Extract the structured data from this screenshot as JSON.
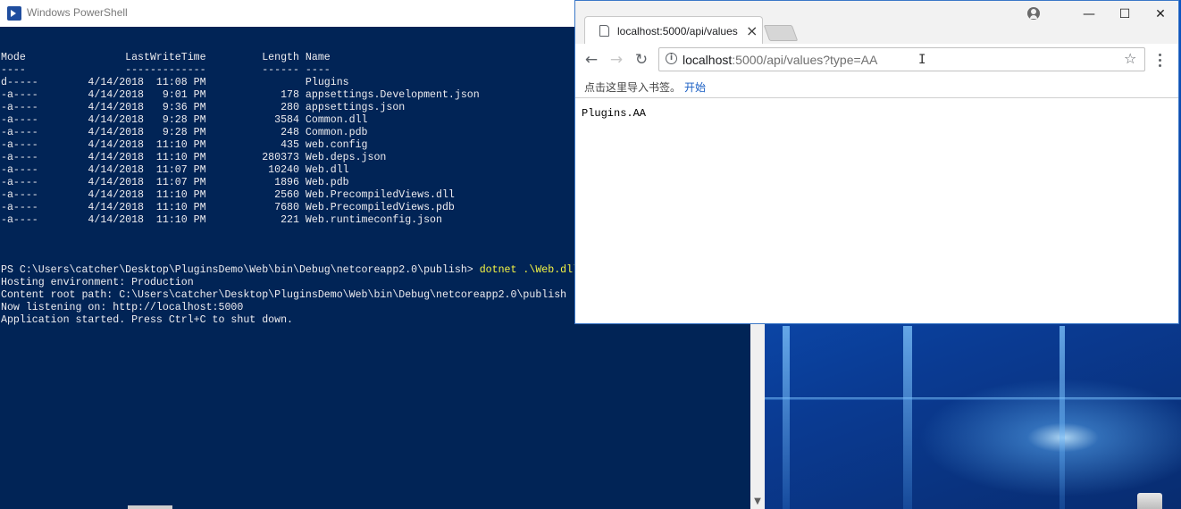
{
  "powershell": {
    "title": "Windows PowerShell",
    "lines": [
      "",
      "",
      "Mode                LastWriteTime         Length Name",
      "----                -------------         ------ ----",
      "d-----        4/14/2018  11:08 PM                Plugins",
      "-a----        4/14/2018   9:01 PM            178 appsettings.Development.json",
      "-a----        4/14/2018   9:36 PM            280 appsettings.json",
      "-a----        4/14/2018   9:28 PM           3584 Common.dll",
      "-a----        4/14/2018   9:28 PM            248 Common.pdb",
      "-a----        4/14/2018  11:10 PM            435 web.config",
      "-a----        4/14/2018  11:10 PM         280373 Web.deps.json",
      "-a----        4/14/2018  11:07 PM          10240 Web.dll",
      "-a----        4/14/2018  11:07 PM           1896 Web.pdb",
      "-a----        4/14/2018  11:10 PM           2560 Web.PrecompiledViews.dll",
      "-a----        4/14/2018  11:10 PM           7680 Web.PrecompiledViews.pdb",
      "-a----        4/14/2018  11:10 PM            221 Web.runtimeconfig.json",
      "",
      "",
      "",
      "PS C:\\Users\\catcher\\Desktop\\PluginsDemo\\Web\\bin\\Debug\\netcoreapp2.0\\publish> ",
      "Hosting environment: Production",
      "Content root path: C:\\Users\\catcher\\Desktop\\PluginsDemo\\Web\\bin\\Debug\\netcoreapp2.0\\publish",
      "Now listening on: http://localhost:5000",
      "Application started. Press Ctrl+C to shut down."
    ],
    "command": "dotnet .\\Web.dll",
    "command_line_index": 19
  },
  "chrome": {
    "tab_title": "localhost:5000/api/values",
    "tab_close": "×",
    "window_controls": {
      "minimize": "—",
      "maximize": "☐",
      "close": "✕"
    },
    "nav": {
      "back": "←",
      "forward": "→",
      "reload": "↻"
    },
    "url_host": "localhost",
    "url_rest": ":5000/api/values?type=AA",
    "info_icon": "i",
    "star": "☆",
    "bookmarks_hint": "点击这里导入书签。",
    "bookmarks_link": "开始",
    "page_content": "Plugins.AA"
  },
  "icons": {
    "powershell": "powershell-icon",
    "profile": "profile-icon",
    "bookmark_star": "star-icon",
    "menu": "three-dot-menu-icon"
  }
}
